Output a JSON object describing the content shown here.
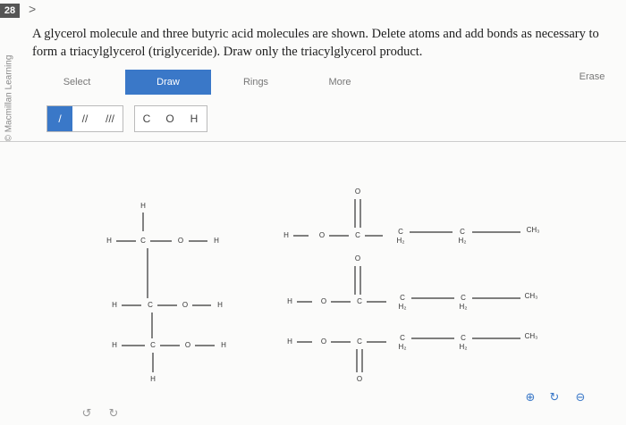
{
  "question_number": "28",
  "nav_arrow": ">",
  "side_label": "© Macmillan Learning",
  "prompt": "A glycerol molecule and three butyric acid molecules are shown. Delete atoms and add bonds as necessary to form a triacylglycerol (triglyceride). Draw only the triacylglycerol product.",
  "toolbar": {
    "tabs": [
      {
        "label": "Select",
        "active": false
      },
      {
        "label": "Draw",
        "active": true
      },
      {
        "label": "Rings",
        "active": false
      },
      {
        "label": "More",
        "active": false
      }
    ],
    "erase_label": "Erase"
  },
  "bond_tools": [
    {
      "label": "/",
      "active": true
    },
    {
      "label": "//",
      "active": false
    },
    {
      "label": "///",
      "active": false
    }
  ],
  "atom_tools": [
    "C",
    "O",
    "H"
  ],
  "molecule_labels": {
    "H": "H",
    "C": "C",
    "O": "O",
    "H2": "H₂",
    "CH3": "CH₃"
  },
  "zoom_controls": [
    "zoom-in",
    "reset",
    "zoom-out"
  ],
  "zoom_glyphs": [
    "⊕",
    "↻",
    "⊖"
  ],
  "undo_glyphs": [
    "↺",
    "↻"
  ]
}
